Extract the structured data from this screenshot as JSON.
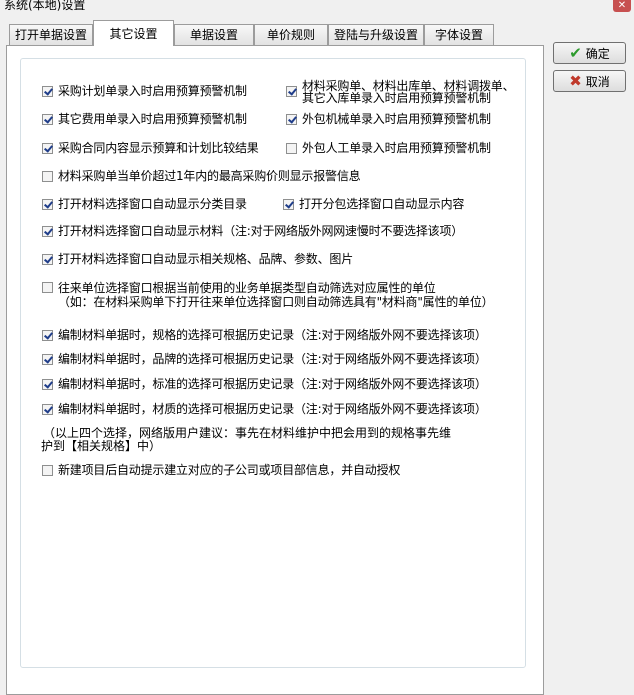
{
  "window": {
    "title": "系统(本地)设置",
    "close_label": "✕"
  },
  "tabs": [
    {
      "label": "打开单据设置"
    },
    {
      "label": "其它设置"
    },
    {
      "label": "单据设置"
    },
    {
      "label": "单价规则"
    },
    {
      "label": "登陆与升级设置"
    },
    {
      "label": "字体设置"
    }
  ],
  "buttons": {
    "ok_label": "确定",
    "cancel_label": "取消"
  },
  "options": [
    {
      "label": "采购计划单录入时启用预算预警机制",
      "checked": true
    },
    {
      "label": "材料采购单、材料出库单、材料调拨单、",
      "label2": "其它入库单录入时启用预算预警机制",
      "checked": true
    },
    {
      "label": "其它费用单录入时启用预算预警机制",
      "checked": true
    },
    {
      "label": "外包机械单录入时启用预算预警机制",
      "checked": true
    },
    {
      "label": "采购合同内容显示预算和计划比较结果",
      "checked": true
    },
    {
      "label": "外包人工单录入时启用预算预警机制",
      "checked": false
    },
    {
      "label": "材料采购单当单价超过1年内的最高采购价则显示报警信息",
      "checked": false
    },
    {
      "label": "打开材料选择窗口自动显示分类目录",
      "checked": true
    },
    {
      "label": "打开分包选择窗口自动显示内容",
      "checked": true
    },
    {
      "label": "打开材料选择窗口自动显示材料（注:对于网络版外网网速慢时不要选择该项）",
      "checked": true
    },
    {
      "label": "打开材料选择窗口自动显示相关规格、品牌、参数、图片",
      "checked": true
    },
    {
      "label": "往来单位选择窗口根据当前使用的业务单据类型自动筛选对应属性的单位",
      "label2": "（如：在材料采购单下打开往来单位选择窗口则自动筛选具有\"材料商\"属性的单位）",
      "checked": false
    },
    {
      "label": "编制材料单据时，规格的选择可根据历史记录（注:对于网络版外网不要选择该项）",
      "checked": true
    },
    {
      "label": "编制材料单据时，品牌的选择可根据历史记录（注:对于网络版外网不要选择该项）",
      "checked": true
    },
    {
      "label": "编制材料单据时，标准的选择可根据历史记录（注:对于网络版外网不要选择该项）",
      "checked": true
    },
    {
      "label": "编制材料单据时，材质的选择可根据历史记录（注:对于网络版外网不要选择该项）",
      "checked": true
    },
    {
      "label": "新建项目后自动提示建立对应的子公司或项目部信息，并自动授权",
      "checked": false
    }
  ],
  "note": {
    "line1": "（以上四个选择，网络版用户建议：事先在材料维护中把会用到的规格事先维",
    "line2": "护到【相关规格】中）"
  }
}
